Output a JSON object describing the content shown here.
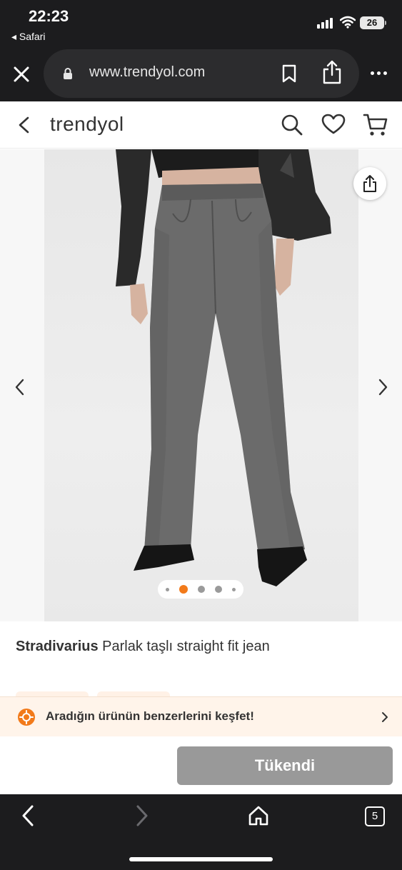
{
  "status_bar": {
    "time": "22:23",
    "back_app": "◂ Safari",
    "battery": "26"
  },
  "browser": {
    "url": "www.trendyol.com",
    "tabs_count": "5"
  },
  "app_header": {
    "logo": "trendyol"
  },
  "gallery": {
    "dot_count": 5,
    "active_dot": 1,
    "accent_color": "#f27a1a"
  },
  "product": {
    "brand": "Stradivarius",
    "name": "Parlak taşlı straight fit jean"
  },
  "discover_banner": {
    "text": "Aradığın ürünün benzerlerini keşfet!"
  },
  "buy_bar": {
    "button_label": "Tükendi"
  },
  "icons": {
    "close": "close-icon",
    "lock": "lock-icon",
    "bookmark": "bookmark-icon",
    "share": "share-icon",
    "more": "more-icon",
    "back": "chevron-left-icon",
    "search": "search-icon",
    "favorite": "heart-icon",
    "cart": "cart-icon",
    "discover": "discover-icon",
    "home": "home-icon"
  }
}
